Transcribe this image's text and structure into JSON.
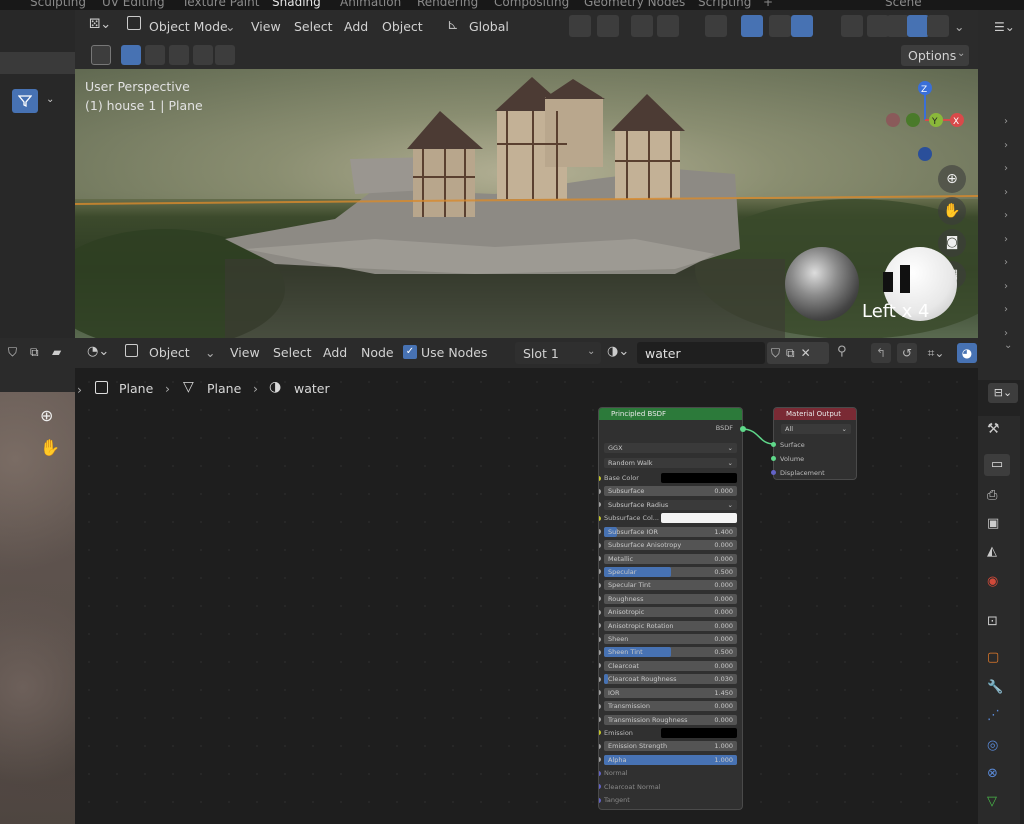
{
  "workspace_tabs": [
    "Sculpting",
    "UV Editing",
    "Texture Paint",
    "Shading",
    "Animation",
    "Rendering",
    "Compositing",
    "Geometry Nodes",
    "Scripting",
    "+",
    "Scene"
  ],
  "viewport": {
    "mode": "Object Mode",
    "menus": [
      "View",
      "Select",
      "Add",
      "Object"
    ],
    "transform_orientation": "Global",
    "options_label": "Options",
    "perspective_label": "User Perspective",
    "object_label": "(1) house 1 | Plane",
    "view_axis_label": "Left x 4",
    "gizmo_axes": {
      "z": "Z",
      "y": "Y",
      "x": "X"
    }
  },
  "node_header": {
    "editor_type": "Object",
    "menus": [
      "View",
      "Select",
      "Add",
      "Node"
    ],
    "use_nodes_label": "Use Nodes",
    "use_nodes_checked": true,
    "slot": "Slot 1",
    "material_name": "water"
  },
  "breadcrumb": [
    "Plane",
    "Plane",
    "water"
  ],
  "bsdf_node": {
    "title": "Principled BSDF",
    "output": "BSDF",
    "distribution": "GGX",
    "subsurface_method": "Random Walk",
    "rows": [
      {
        "label": "Base Color",
        "type": "color",
        "color": "#000000"
      },
      {
        "label": "Subsurface",
        "value": "0.000",
        "fill": 0
      },
      {
        "label": "Subsurface Radius",
        "type": "select"
      },
      {
        "label": "Subsurface Col...",
        "type": "color",
        "color": "#f2f2f2"
      },
      {
        "label": "Subsurface IOR",
        "value": "1.400",
        "fill": 0.1
      },
      {
        "label": "Subsurface Anisotropy",
        "value": "0.000",
        "fill": 0
      },
      {
        "label": "Metallic",
        "value": "0.000",
        "fill": 0
      },
      {
        "label": "Specular",
        "value": "0.500",
        "fill": 0.5
      },
      {
        "label": "Specular Tint",
        "value": "0.000",
        "fill": 0
      },
      {
        "label": "Roughness",
        "value": "0.000",
        "fill": 0
      },
      {
        "label": "Anisotropic",
        "value": "0.000",
        "fill": 0
      },
      {
        "label": "Anisotropic Rotation",
        "value": "0.000",
        "fill": 0
      },
      {
        "label": "Sheen",
        "value": "0.000",
        "fill": 0
      },
      {
        "label": "Sheen Tint",
        "value": "0.500",
        "fill": 0.5
      },
      {
        "label": "Clearcoat",
        "value": "0.000",
        "fill": 0
      },
      {
        "label": "Clearcoat Roughness",
        "value": "0.030",
        "fill": 0.03
      },
      {
        "label": "IOR",
        "value": "1.450",
        "fill": 0
      },
      {
        "label": "Transmission",
        "value": "0.000",
        "fill": 0
      },
      {
        "label": "Transmission Roughness",
        "value": "0.000",
        "fill": 0
      },
      {
        "label": "Emission",
        "type": "color",
        "color": "#000000"
      },
      {
        "label": "Emission Strength",
        "value": "1.000",
        "fill": 0
      },
      {
        "label": "Alpha",
        "value": "1.000",
        "fill": 1
      },
      {
        "label": "Normal",
        "type": "plain"
      },
      {
        "label": "Clearcoat Normal",
        "type": "plain"
      },
      {
        "label": "Tangent",
        "type": "plain"
      }
    ]
  },
  "material_output": {
    "title": "Material Output",
    "target": "All",
    "inputs": [
      "Surface",
      "Volume",
      "Displacement"
    ]
  },
  "colors": {
    "accent": "#4772b3",
    "bsdf_header": "#2c7a3a",
    "output_header": "#7a2a34"
  }
}
